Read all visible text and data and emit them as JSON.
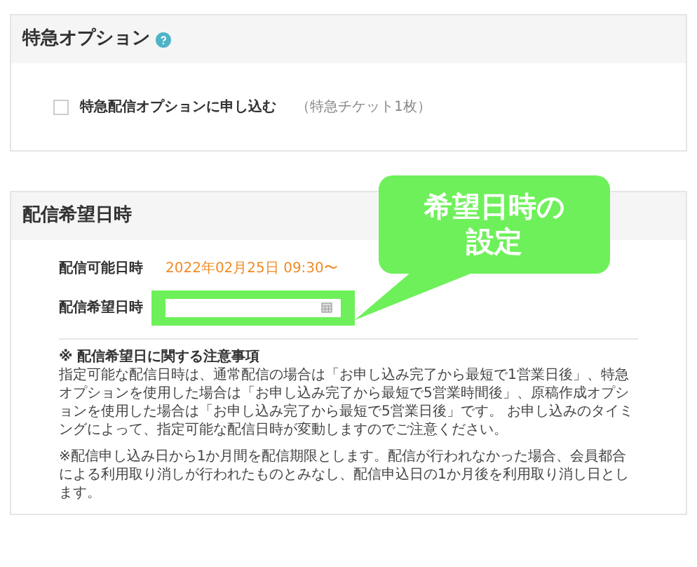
{
  "urgent_option": {
    "title": "特急オプション",
    "checkbox": {
      "label": "特急配信オプションに申し込む",
      "checked": false
    },
    "ticket_note": "（特急チケット1枚）"
  },
  "delivery": {
    "title": "配信希望日時",
    "rows": [
      {
        "kind": "text",
        "label": "配信可能日時",
        "value": "2022年02月25日 09:30〜"
      },
      {
        "kind": "date",
        "label": "配信希望日時"
      }
    ],
    "notes_heading": "※ 配信希望日に関する注意事項",
    "notes": [
      "指定可能な配信日時は、通常配信の場合は「お申し込み完了から最短で1営業日後」、特急オプションを使用した場合は「お申し込み完了から最短で5営業時間後」、原稿作成オプションを使用した場合は「お申し込み完了から最短で5営業日後」です。 お申し込みのタイミングによって、指定可能な配信日時が変動しますのでご注意ください。",
      "※配信申し込み日から1か月間を配信期限とします。配信が行われなかった場合、会員都合による利用取り消しが行われたものとみなし、配信申込日の1か月後を利用取り消し日とします。"
    ]
  },
  "callout": {
    "lines": [
      "希望日時の",
      "設定"
    ]
  }
}
